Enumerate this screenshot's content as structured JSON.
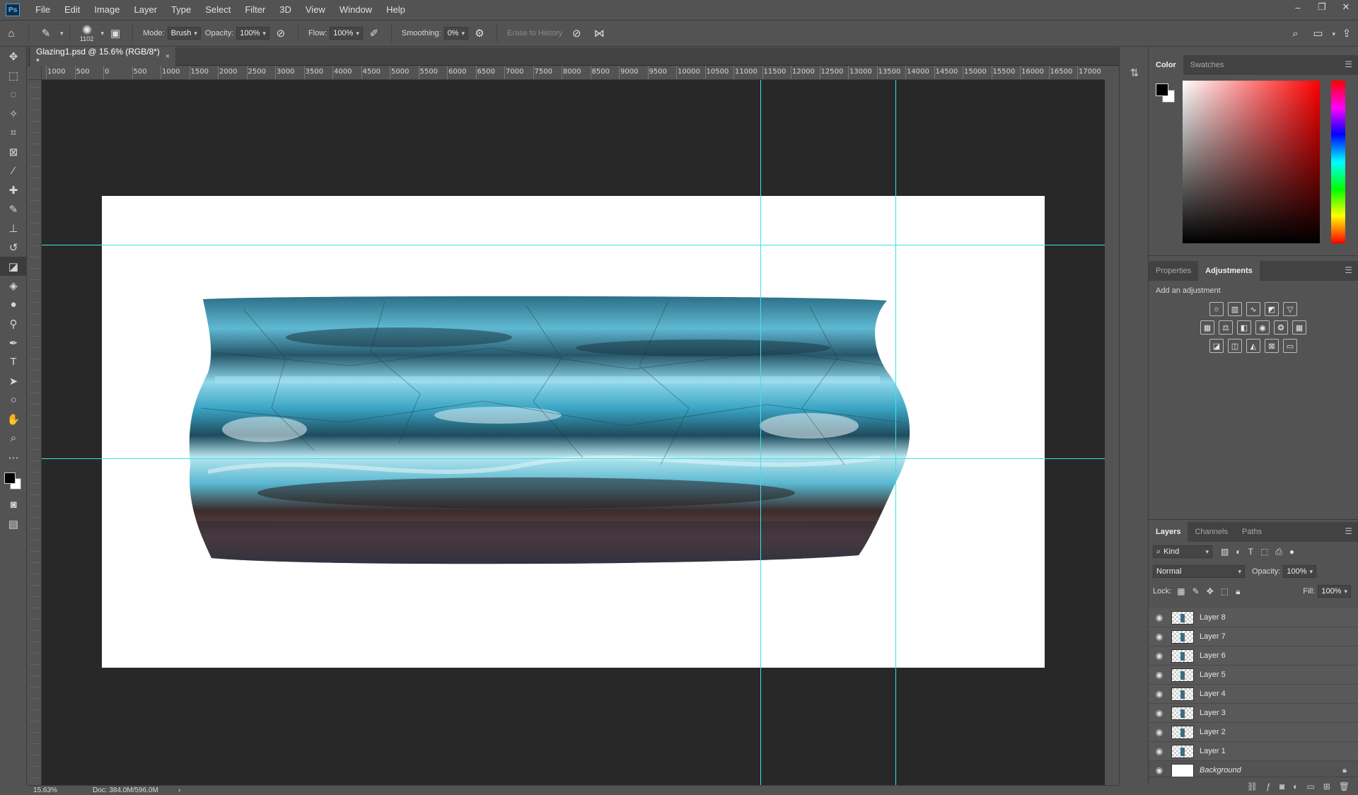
{
  "app": {
    "logo": "Ps"
  },
  "menu": [
    "File",
    "Edit",
    "Image",
    "Layer",
    "Type",
    "Select",
    "Filter",
    "3D",
    "View",
    "Window",
    "Help"
  ],
  "window_controls": {
    "minimize": "–",
    "restore": "❐",
    "close": "✕"
  },
  "options_bar": {
    "brush_size": "1102",
    "mode_label": "Mode:",
    "mode_value": "Brush",
    "opacity_label": "Opacity:",
    "opacity_value": "100%",
    "flow_label": "Flow:",
    "flow_value": "100%",
    "smoothing_label": "Smoothing:",
    "smoothing_value": "0%",
    "erase_history_label": "Erase to History"
  },
  "document": {
    "tab_title": "Glazing1.psd @ 15.6% (RGB/8*) *",
    "close": "×"
  },
  "ruler_top_labels": [
    "1000",
    "500",
    "0",
    "500",
    "1000",
    "1500",
    "2000",
    "2500",
    "3000",
    "3500",
    "4000",
    "4500",
    "5000",
    "5500",
    "6000",
    "6500",
    "7000",
    "7500",
    "8000",
    "8500",
    "9000",
    "9500",
    "10000",
    "10500",
    "11000",
    "11500",
    "12000",
    "12500",
    "13000",
    "13500",
    "14000",
    "14500",
    "15000",
    "15500",
    "16000",
    "16500",
    "17000"
  ],
  "color_panel": {
    "tabs": [
      "Color",
      "Swatches"
    ],
    "fg": "#000000",
    "bg": "#ffffff"
  },
  "adjustments_panel": {
    "tabs": [
      "Properties",
      "Adjustments"
    ],
    "title": "Add an adjustment",
    "rows": [
      [
        "brightness-icon",
        "levels-icon",
        "curves-icon",
        "exposure-icon",
        "gradient-triangle-icon"
      ],
      [
        "vibrance-icon",
        "color-balance-icon",
        "black-white-icon",
        "photo-filter-icon",
        "channel-mixer-icon",
        "color-lookup-icon"
      ],
      [
        "invert-icon",
        "posterize-icon",
        "threshold-icon",
        "selective-color-icon",
        "gradient-map-icon"
      ]
    ]
  },
  "layers_panel": {
    "tabs": [
      "Layers",
      "Channels",
      "Paths"
    ],
    "kind_label": "Kind",
    "blend_mode": "Normal",
    "opacity_label": "Opacity:",
    "opacity_value": "100%",
    "lock_label": "Lock:",
    "fill_label": "Fill:",
    "fill_value": "100%",
    "layers": [
      {
        "name": "Layer 8"
      },
      {
        "name": "Layer 7"
      },
      {
        "name": "Layer 6"
      },
      {
        "name": "Layer 5"
      },
      {
        "name": "Layer 4"
      },
      {
        "name": "Layer 3"
      },
      {
        "name": "Layer 2"
      },
      {
        "name": "Layer 1"
      }
    ],
    "background_layer": "Background"
  },
  "status": {
    "zoom": "15.63%",
    "doc": "Doc: 384.0M/596.0M",
    "arrow": "›"
  },
  "colors": {
    "guide": "#3fe0e6",
    "pasteboard": "#282828",
    "ui": "#535353"
  }
}
